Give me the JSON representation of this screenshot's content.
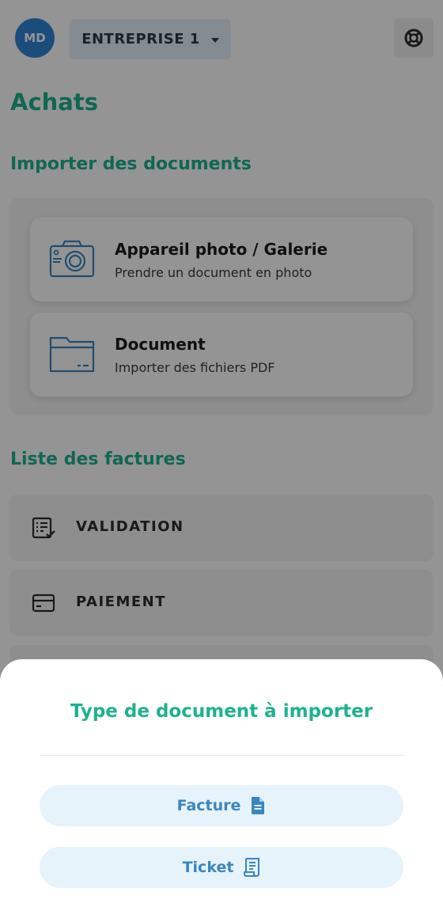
{
  "header": {
    "avatar_initials": "MD",
    "company_label": "ENTREPRISE 1"
  },
  "page_title": "Achats",
  "import_section": {
    "title": "Importer des documents",
    "cards": [
      {
        "title": "Appareil photo / Galerie",
        "subtitle": "Prendre un document en photo",
        "icon": "camera-icon"
      },
      {
        "title": "Document",
        "subtitle": "Importer des fichiers PDF",
        "icon": "folder-icon"
      }
    ]
  },
  "invoices_section": {
    "title": "Liste des factures",
    "rows": [
      {
        "label": "VALIDATION",
        "icon": "checklist-icon"
      },
      {
        "label": "PAIEMENT",
        "icon": "card-icon"
      }
    ]
  },
  "sheet": {
    "title": "Type de document à importer",
    "options": [
      {
        "label": "Facture",
        "icon": "document-icon"
      },
      {
        "label": "Ticket",
        "icon": "receipt-icon"
      }
    ]
  },
  "colors": {
    "accent_green": "#1db28f",
    "accent_blue": "#3a86bf",
    "avatar_blue": "#2f86d6",
    "pill_bg": "#e6f3fb"
  }
}
